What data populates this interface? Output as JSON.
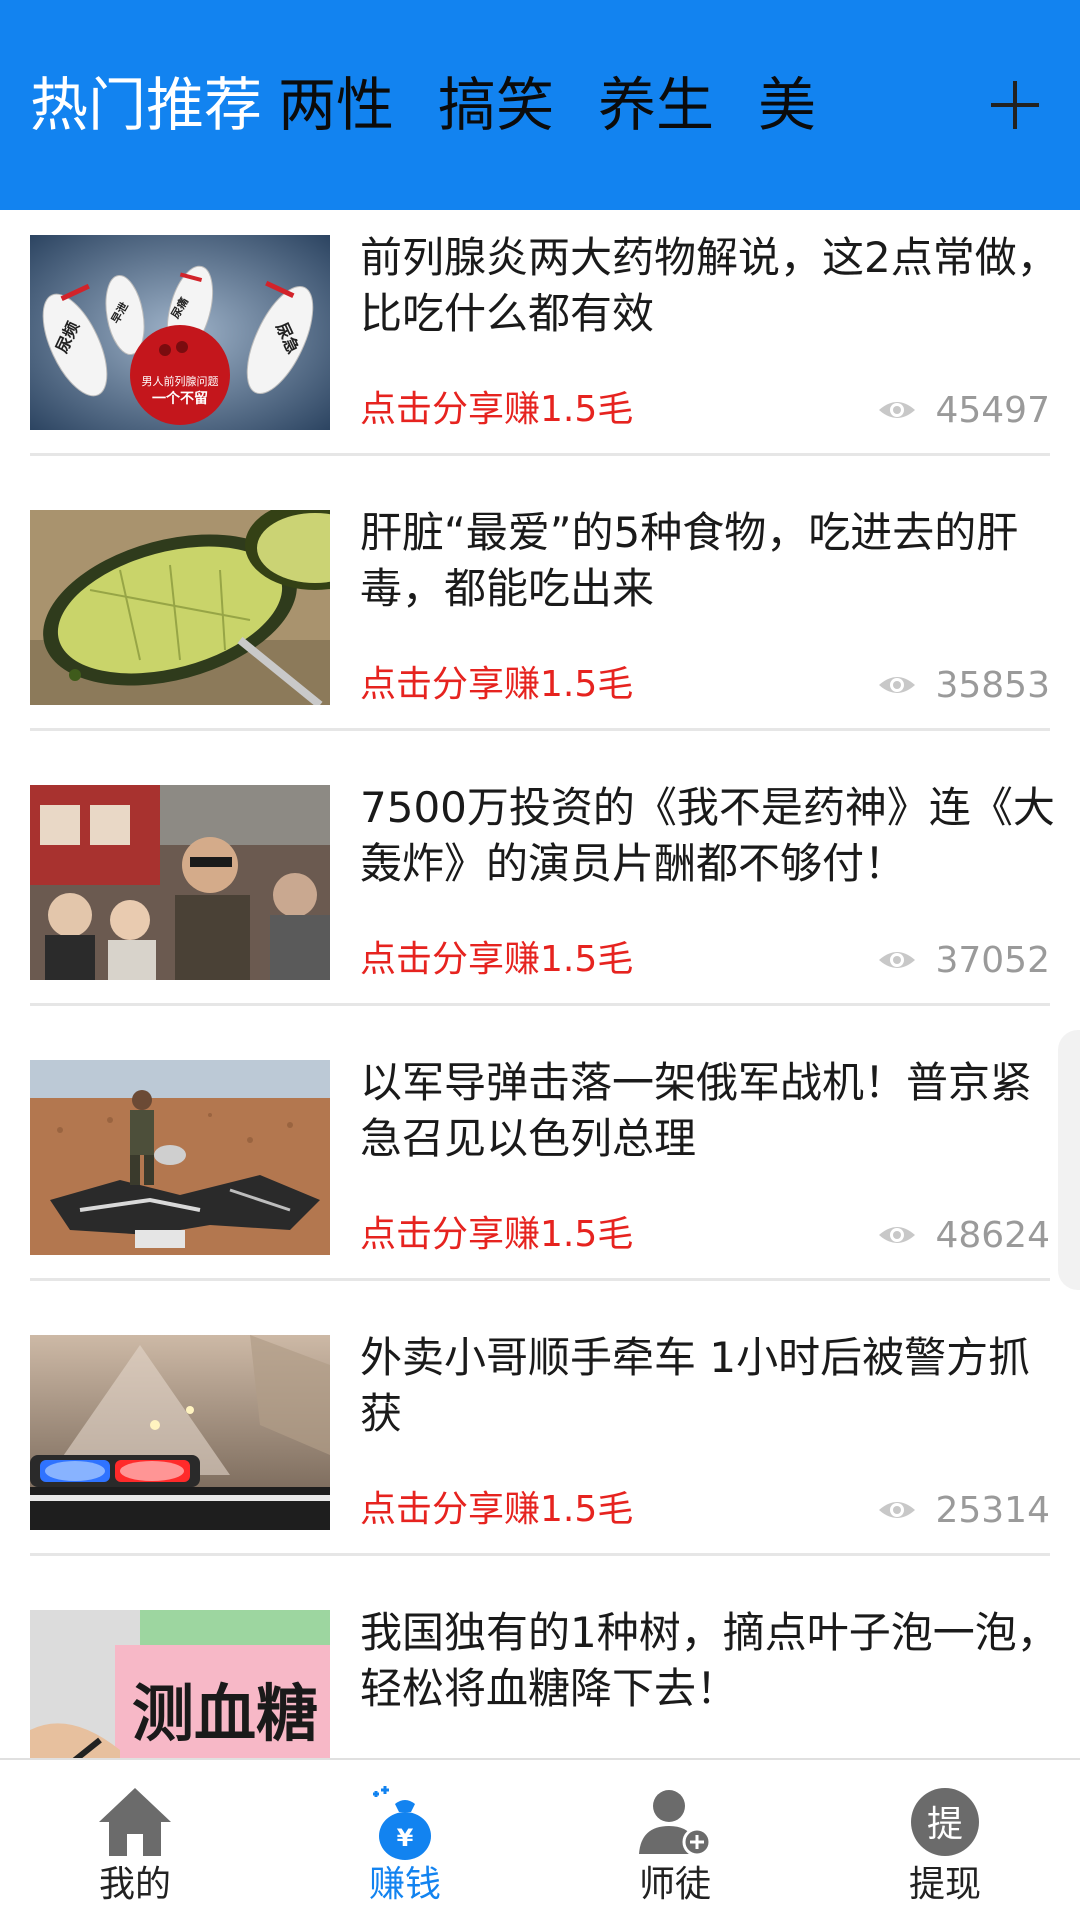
{
  "header": {
    "tabs": [
      {
        "label": "热门推荐",
        "active": true
      },
      {
        "label": "两性",
        "active": false
      },
      {
        "label": "搞笑",
        "active": false
      },
      {
        "label": "养生",
        "active": false
      },
      {
        "label": "美",
        "active": false
      }
    ],
    "add_icon": "plus-icon",
    "background_color": "#1283f0"
  },
  "feed": {
    "items": [
      {
        "title": "前列腺炎两大药物解说，这2点常做，比吃什么都有效",
        "share_label": "点击分享赚1.5毛",
        "views": "45497",
        "thumb_text": {
          "pin1": "尿频",
          "pin2": "尿急",
          "pin3": "尿痛",
          "pin4": "早泄",
          "ball_line1": "男人前列腺问题",
          "ball_line2": "一个不留"
        }
      },
      {
        "title": "肝脏“最爱”的5种食物，吃进去的肝毒，都能吃出来",
        "share_label": "点击分享赚1.5毛",
        "views": "35853"
      },
      {
        "title": "7500万投资的《我不是药神》连《大轰炸》的演员片酬都不够付！",
        "share_label": "点击分享赚1.5毛",
        "views": "37052"
      },
      {
        "title": "以军导弹击落一架俄军战机！普京紧急召见以色列总理",
        "share_label": "点击分享赚1.5毛",
        "views": "48624"
      },
      {
        "title": "外卖小哥顺手牵车 1小时后被警方抓获",
        "share_label": "点击分享赚1.5毛",
        "views": "25314"
      },
      {
        "title": "我国独有的1种树，摘点叶子泡一泡，轻松将血糖降下去！",
        "share_label": "",
        "views": "",
        "thumb_text": "测血糖"
      }
    ],
    "share_color": "#e6231f",
    "view_icon": "eye-icon"
  },
  "bottom_nav": {
    "items": [
      {
        "label": "我的",
        "icon": "home-icon",
        "active": false
      },
      {
        "label": "赚钱",
        "icon": "money-bag-icon",
        "active": true
      },
      {
        "label": "师徒",
        "icon": "user-add-icon",
        "active": false
      },
      {
        "label": "提现",
        "icon": "withdraw-icon",
        "active": false,
        "icon_glyph": "提"
      }
    ],
    "active_color": "#1283f0"
  }
}
